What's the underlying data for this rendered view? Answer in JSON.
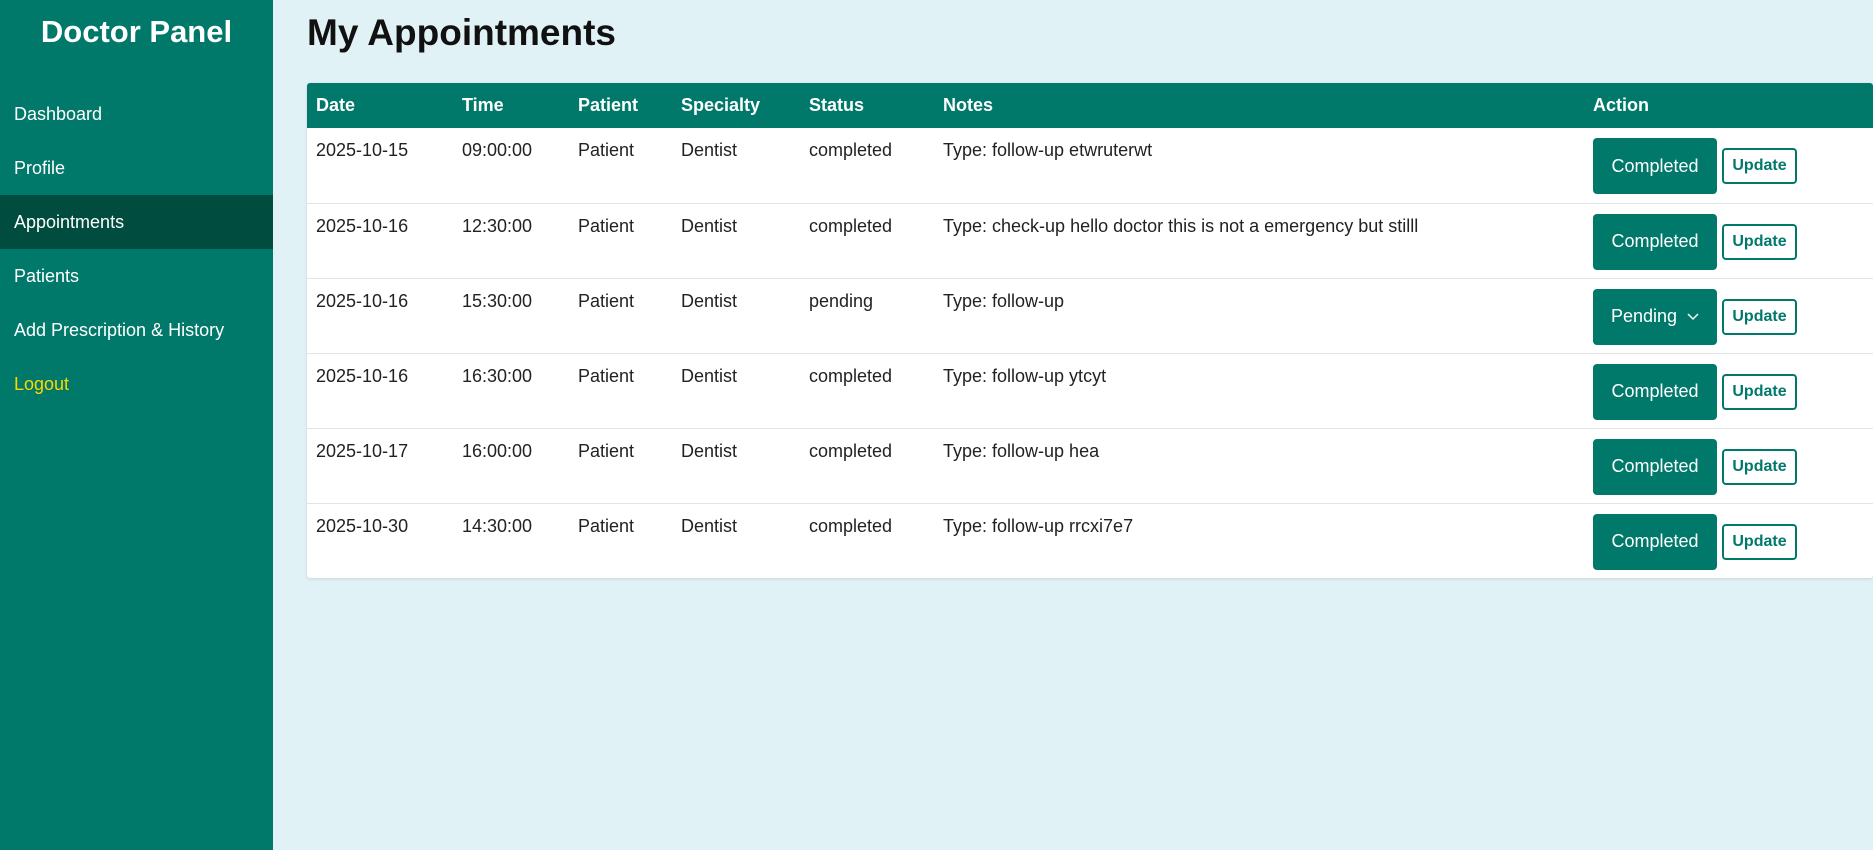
{
  "sidebar": {
    "title": "Doctor Panel",
    "items": [
      {
        "label": "Dashboard"
      },
      {
        "label": "Profile"
      },
      {
        "label": "Appointments"
      },
      {
        "label": "Patients"
      },
      {
        "label": "Add Prescription & History"
      },
      {
        "label": "Logout"
      }
    ]
  },
  "main": {
    "title": "My Appointments",
    "columns": [
      "Date",
      "Time",
      "Patient",
      "Specialty",
      "Status",
      "Notes",
      "Action"
    ],
    "update_label": "Update",
    "rows": [
      {
        "date": "2025-10-15",
        "time": "09:00:00",
        "patient": "Patient",
        "specialty": "Dentist",
        "status": "completed",
        "notes": "Type: follow-up etwruterwt",
        "action_status": "Completed"
      },
      {
        "date": "2025-10-16",
        "time": "12:30:00",
        "patient": "Patient",
        "specialty": "Dentist",
        "status": "completed",
        "notes": "Type: check-up hello doctor this is not a emergency but stilll",
        "action_status": "Completed"
      },
      {
        "date": "2025-10-16",
        "time": "15:30:00",
        "patient": "Patient",
        "specialty": "Dentist",
        "status": "pending",
        "notes": "Type: follow-up",
        "action_status": "Pending"
      },
      {
        "date": "2025-10-16",
        "time": "16:30:00",
        "patient": "Patient",
        "specialty": "Dentist",
        "status": "completed",
        "notes": "Type: follow-up ytcyt",
        "action_status": "Completed"
      },
      {
        "date": "2025-10-17",
        "time": "16:00:00",
        "patient": "Patient",
        "specialty": "Dentist",
        "status": "completed",
        "notes": "Type: follow-up hea",
        "action_status": "Completed"
      },
      {
        "date": "2025-10-30",
        "time": "14:30:00",
        "patient": "Patient",
        "specialty": "Dentist",
        "status": "completed",
        "notes": "Type: follow-up rrcxi7e7",
        "action_status": "Completed"
      }
    ]
  },
  "colors": {
    "primary": "#00796b",
    "primary_dark": "#004d40",
    "background": "#e1f2f6",
    "logout": "#ffd600"
  }
}
